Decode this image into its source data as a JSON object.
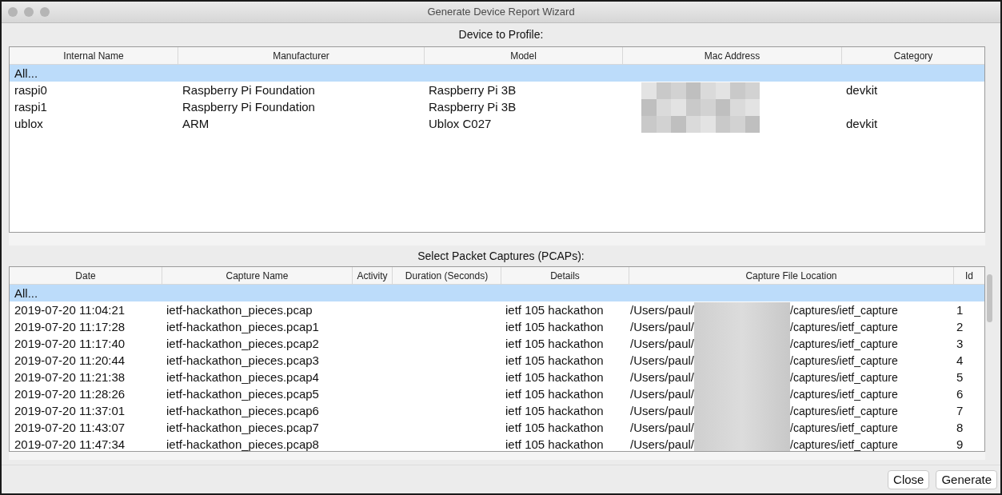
{
  "window": {
    "title": "Generate Device Report Wizard"
  },
  "devices": {
    "label": "Device to Profile:",
    "columns": [
      "Internal Name",
      "Manufacturer",
      "Model",
      "Mac Address",
      "Category"
    ],
    "rows": [
      {
        "selected": true,
        "cells": [
          "All...",
          "",
          "",
          "",
          ""
        ]
      },
      {
        "selected": false,
        "cells": [
          "raspi0",
          "Raspberry Pi Foundation",
          "Raspberry Pi 3B",
          "",
          "devkit"
        ]
      },
      {
        "selected": false,
        "cells": [
          "raspi1",
          "Raspberry Pi Foundation",
          "Raspberry Pi 3B",
          "",
          ""
        ]
      },
      {
        "selected": false,
        "cells": [
          "ublox",
          "ARM",
          "Ublox C027",
          "",
          "devkit"
        ]
      }
    ]
  },
  "captures": {
    "label": "Select Packet Captures (PCAPs):",
    "columns": [
      "Date",
      "Capture Name",
      "Activity",
      "Duration (Seconds)",
      "Details",
      "Capture File Location",
      "Id"
    ],
    "rows": [
      {
        "selected": true,
        "all": "All..."
      },
      {
        "selected": false,
        "date": "2019-07-20 11:04:21",
        "name": "ietf-hackathon_pieces.pcap",
        "details": "ietf 105 hackathon",
        "path_start": "/Users/paul/",
        "path_end": "/captures/ietf_capture",
        "id": "1"
      },
      {
        "selected": false,
        "date": "2019-07-20 11:17:28",
        "name": "ietf-hackathon_pieces.pcap1",
        "details": "ietf 105 hackathon",
        "path_start": "/Users/paul/",
        "path_end": "/captures/ietf_capture",
        "id": "2"
      },
      {
        "selected": false,
        "date": "2019-07-20 11:17:40",
        "name": "ietf-hackathon_pieces.pcap2",
        "details": "ietf 105 hackathon",
        "path_start": "/Users/paul/",
        "path_end": "/captures/ietf_capture",
        "id": "3"
      },
      {
        "selected": false,
        "date": "2019-07-20 11:20:44",
        "name": "ietf-hackathon_pieces.pcap3",
        "details": "ietf 105 hackathon",
        "path_start": "/Users/paul/",
        "path_end": "/captures/ietf_capture",
        "id": "4"
      },
      {
        "selected": false,
        "date": "2019-07-20 11:21:38",
        "name": "ietf-hackathon_pieces.pcap4",
        "details": "ietf 105 hackathon",
        "path_start": "/Users/paul/",
        "path_end": "/captures/ietf_capture",
        "id": "5"
      },
      {
        "selected": false,
        "date": "2019-07-20 11:28:26",
        "name": "ietf-hackathon_pieces.pcap5",
        "details": "ietf 105 hackathon",
        "path_start": "/Users/paul/",
        "path_end": "/captures/ietf_capture",
        "id": "6"
      },
      {
        "selected": false,
        "date": "2019-07-20 11:37:01",
        "name": "ietf-hackathon_pieces.pcap6",
        "details": "ietf 105 hackathon",
        "path_start": "/Users/paul/",
        "path_end": "/captures/ietf_capture",
        "id": "7"
      },
      {
        "selected": false,
        "date": "2019-07-20 11:43:07",
        "name": "ietf-hackathon_pieces.pcap7",
        "details": "ietf 105 hackathon",
        "path_start": "/Users/paul/",
        "path_end": "/captures/ietf_capture",
        "id": "8"
      },
      {
        "selected": false,
        "date": "2019-07-20 11:47:34",
        "name": "ietf-hackathon_pieces.pcap8",
        "details": "ietf 105 hackathon",
        "path_start": "/Users/paul/",
        "path_end": "/captures/ietf_capture",
        "id": "9"
      }
    ]
  },
  "buttons": [
    "Close",
    "Generate"
  ]
}
